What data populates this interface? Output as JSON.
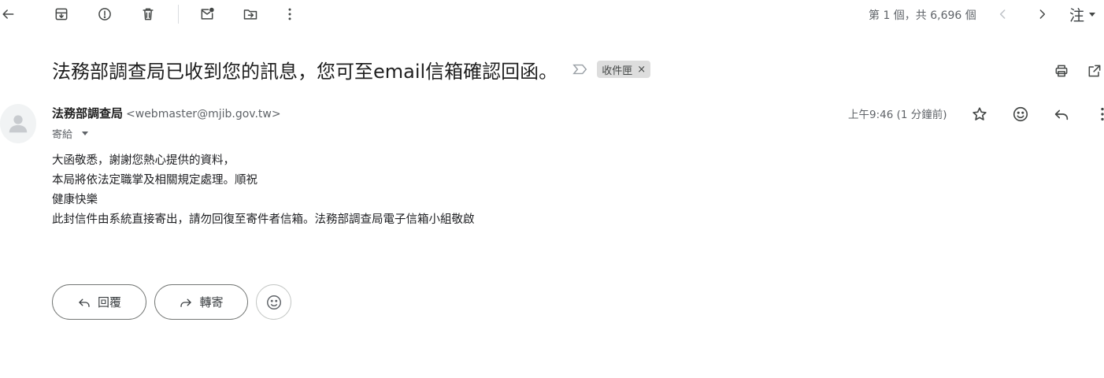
{
  "toolbar": {
    "back_icon": "arrow-left-icon",
    "archive_icon": "archive-icon",
    "report_icon": "report-spam-icon",
    "delete_icon": "trash-icon",
    "mark_unread_icon": "mark-unread-icon",
    "move_icon": "move-to-folder-icon",
    "more_icon": "more-vert-icon",
    "pager_text": "第 1 個，共 6,696 個",
    "prev_icon": "chevron-left-icon",
    "next_icon": "chevron-right-icon",
    "input_tool_label": "注"
  },
  "email": {
    "subject": "法務部調查局已收到您的訊息，您可至email信箱確認回函。",
    "label_chip": "收件匣",
    "label_remove": "×",
    "sender_name": "法務部調查局",
    "sender_email": "<webmaster@mjib.gov.tw>",
    "recipient_label": "寄給",
    "timestamp": "上午9:46 (1 分鐘前)",
    "body_lines": [
      "大函敬悉，謝謝您熱心提供的資料，",
      "本局將依法定職掌及相關規定處理。順祝",
      "健康快樂",
      "此封信件由系統直接寄出，請勿回復至寄件者信箱。法務部調查局電子信箱小組敬啟"
    ]
  },
  "actions": {
    "reply_label": "回覆",
    "forward_label": "轉寄"
  },
  "colors": {
    "text_primary": "#1f1f1f",
    "text_secondary": "#5f6368",
    "chip_bg": "#dddddd",
    "border": "#747775"
  }
}
